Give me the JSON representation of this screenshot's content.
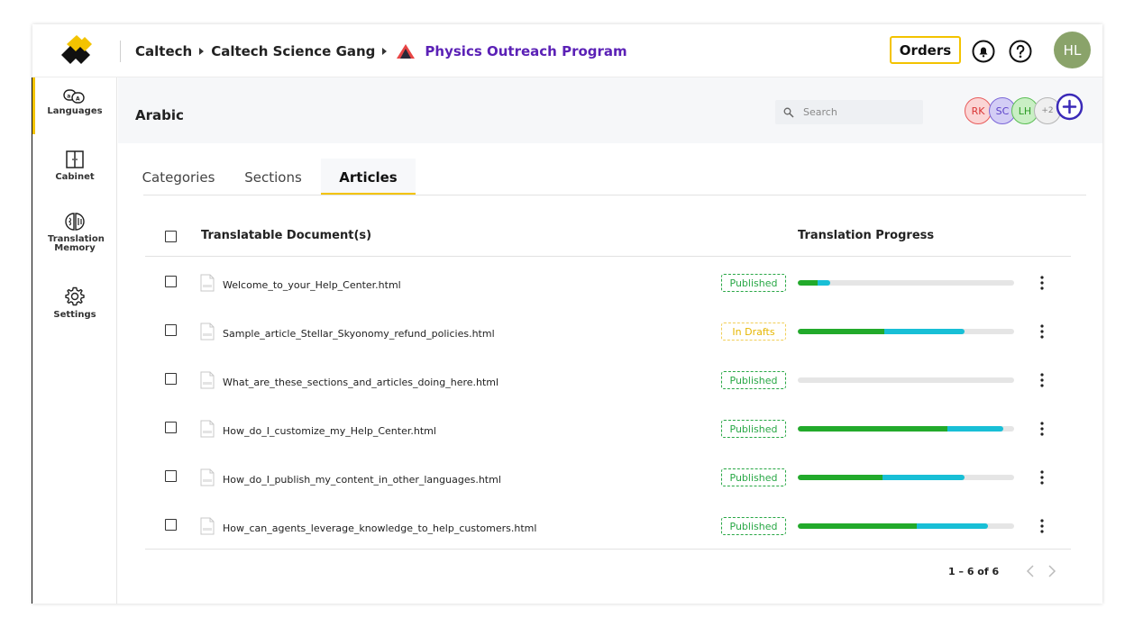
{
  "breadcrumb": {
    "org": "Caltech",
    "team": "Caltech Science Gang",
    "program": "Physics Outreach Program"
  },
  "header": {
    "orders_label": "Orders",
    "user_initials": "HL"
  },
  "sidebar": {
    "items": [
      {
        "label": "Languages"
      },
      {
        "label": "Cabinet"
      },
      {
        "label": "Translation Memory"
      },
      {
        "label": "Settings"
      }
    ]
  },
  "language": {
    "title": "Arabic",
    "search_placeholder": "Search",
    "collaborators": [
      "RK",
      "SC",
      "LH"
    ],
    "more_collaborators": "+2"
  },
  "tabs": [
    {
      "label": "Categories"
    },
    {
      "label": "Sections"
    },
    {
      "label": "Articles"
    }
  ],
  "active_tab": "Articles",
  "table": {
    "headers": {
      "document": "Translatable Document(s)",
      "progress": "Translation Progress"
    },
    "rows": [
      {
        "name": "Welcome_to_your_Help_Center.html",
        "status": "Published",
        "done": 0.09,
        "in_progress": 0.06
      },
      {
        "name": "Sample_article_Stellar_Skyonomy_refund_policies.html",
        "status": "In Drafts",
        "done": 0.4,
        "in_progress": 0.37
      },
      {
        "name": "What_are_these_sections_and_articles_doing_here.html",
        "status": "Published",
        "done": 0.0,
        "in_progress": 0.0
      },
      {
        "name": "How_do_I_customize_my_Help_Center.html",
        "status": "Published",
        "done": 0.69,
        "in_progress": 0.26
      },
      {
        "name": "How_do_I_publish_my_content_in_other_languages.html",
        "status": "Published",
        "done": 0.39,
        "in_progress": 0.38
      },
      {
        "name": "How_can_agents_leverage_knowledge_to_help_customers.html",
        "status": "Published",
        "done": 0.55,
        "in_progress": 0.33
      }
    ]
  },
  "pagination": {
    "range": "1 – 6 of 6"
  },
  "colors": {
    "accent": "#f3c300",
    "program": "#5b21b6",
    "published": "#28a745",
    "draft": "#e6b600",
    "progress_done": "#22aa2b",
    "progress_in_progress": "#18bfd6"
  }
}
